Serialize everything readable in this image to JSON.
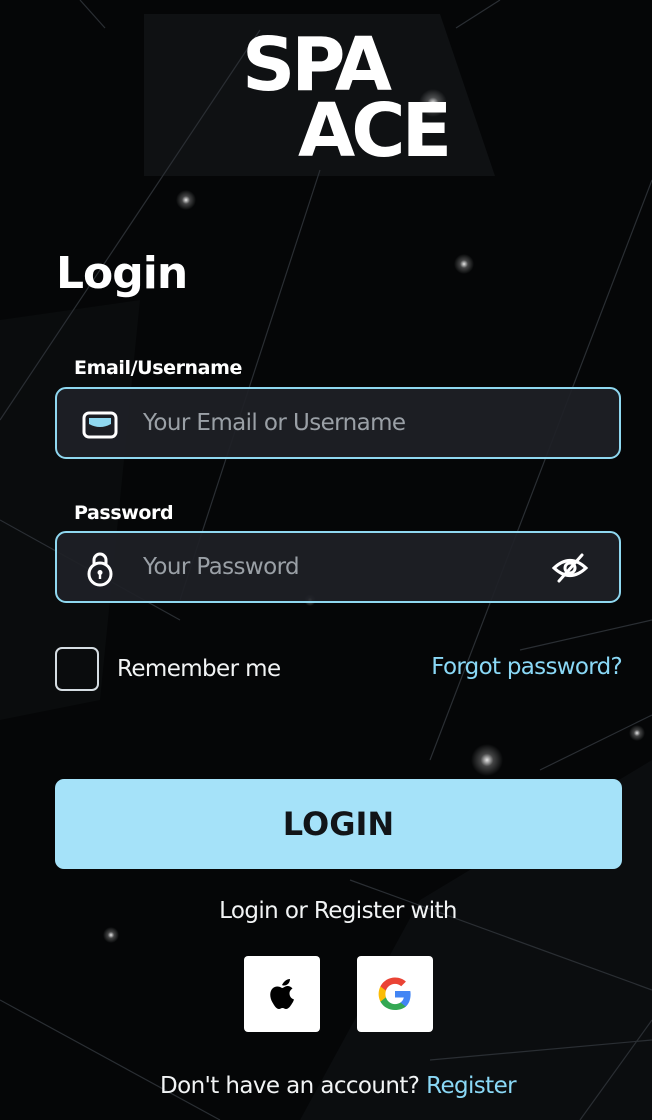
{
  "logo": {
    "line1": "SPA",
    "line2": "ACE"
  },
  "page_title": "Login",
  "email": {
    "label": "Email/Username",
    "placeholder": "Your Email or Username",
    "value": ""
  },
  "password": {
    "label": "Password",
    "placeholder": "Your Password",
    "value": ""
  },
  "remember_label": "Remember me",
  "forgot_label": "Forgot password?",
  "login_button": "LOGIN",
  "social_prompt": "Login or Register with",
  "signup": {
    "prompt": "Don't have an account?",
    "link": "Register"
  },
  "icons": {
    "email": "envelope-icon",
    "password": "lock-icon",
    "toggle_visibility": "eye-off-icon",
    "apple": "apple-icon",
    "google": "google-icon"
  },
  "colors": {
    "background": "#050607",
    "accent": "#8ad8f6",
    "button": "#a5e2f9",
    "field_border": "#8fd8f0"
  }
}
